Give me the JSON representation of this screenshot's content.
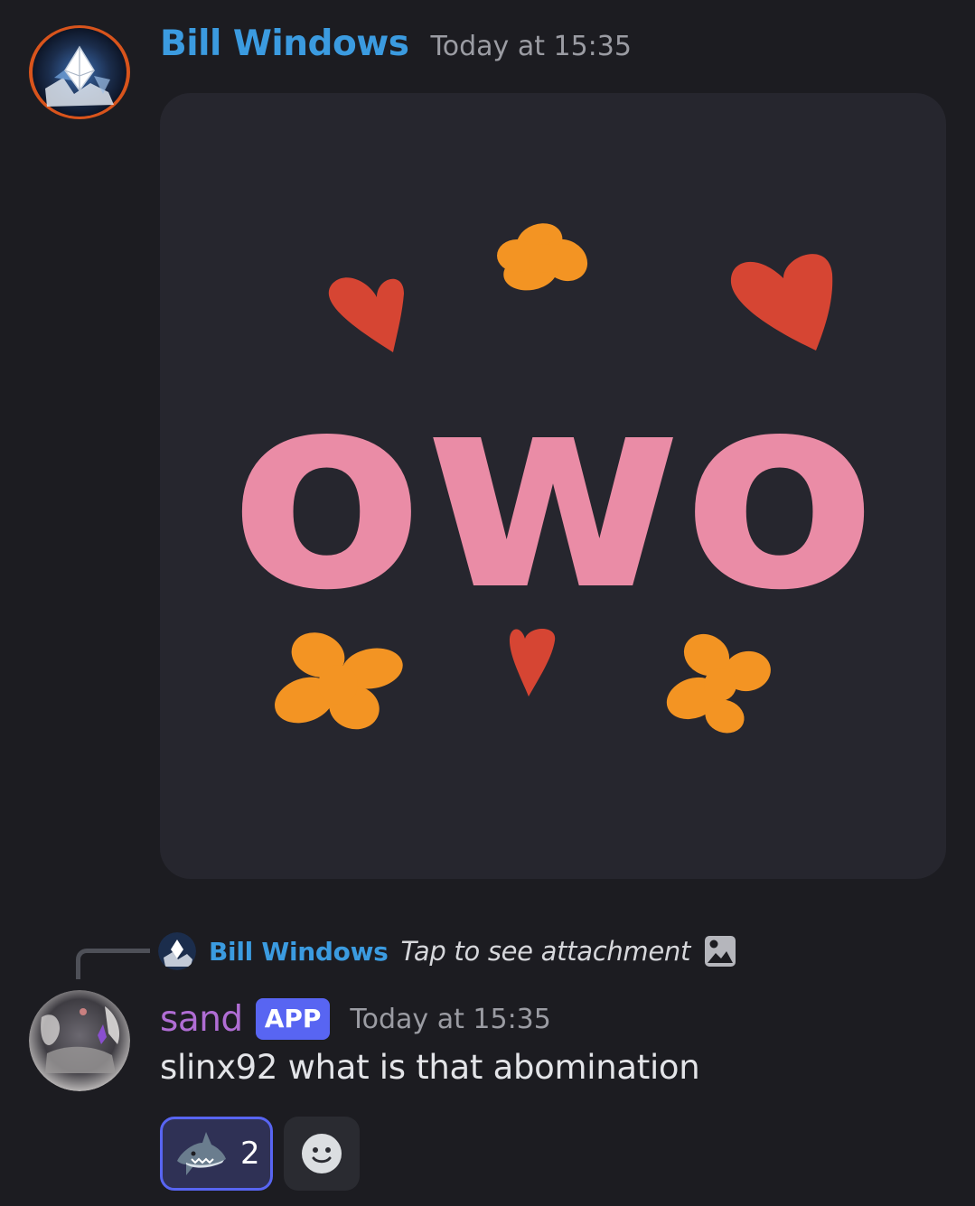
{
  "messages": [
    {
      "author": "Bill Windows",
      "timestamp": "Today at 15:35",
      "author_color": "#3b9be0",
      "attachment": {
        "type": "sticker",
        "text": "owo",
        "background": "#26262e",
        "colors": {
          "text": "#ea8ca6",
          "heart": "#d64533",
          "flower": "#f39423"
        }
      }
    },
    {
      "reply_to": {
        "author": "Bill Windows",
        "text": "Tap to see attachment",
        "icon": "image-icon"
      },
      "author": "sand",
      "author_color": "#b06dd4",
      "badge": "APP",
      "timestamp": "Today at 15:35",
      "content": "slinx92 what is that abomination",
      "reactions": [
        {
          "emoji": "shark-icon",
          "count": "2",
          "selected": true
        },
        {
          "emoji": "add-reaction-icon"
        }
      ]
    }
  ],
  "colors": {
    "background": "#1c1c21",
    "accent": "#5865f2",
    "timestamp": "#9b9ca3"
  }
}
